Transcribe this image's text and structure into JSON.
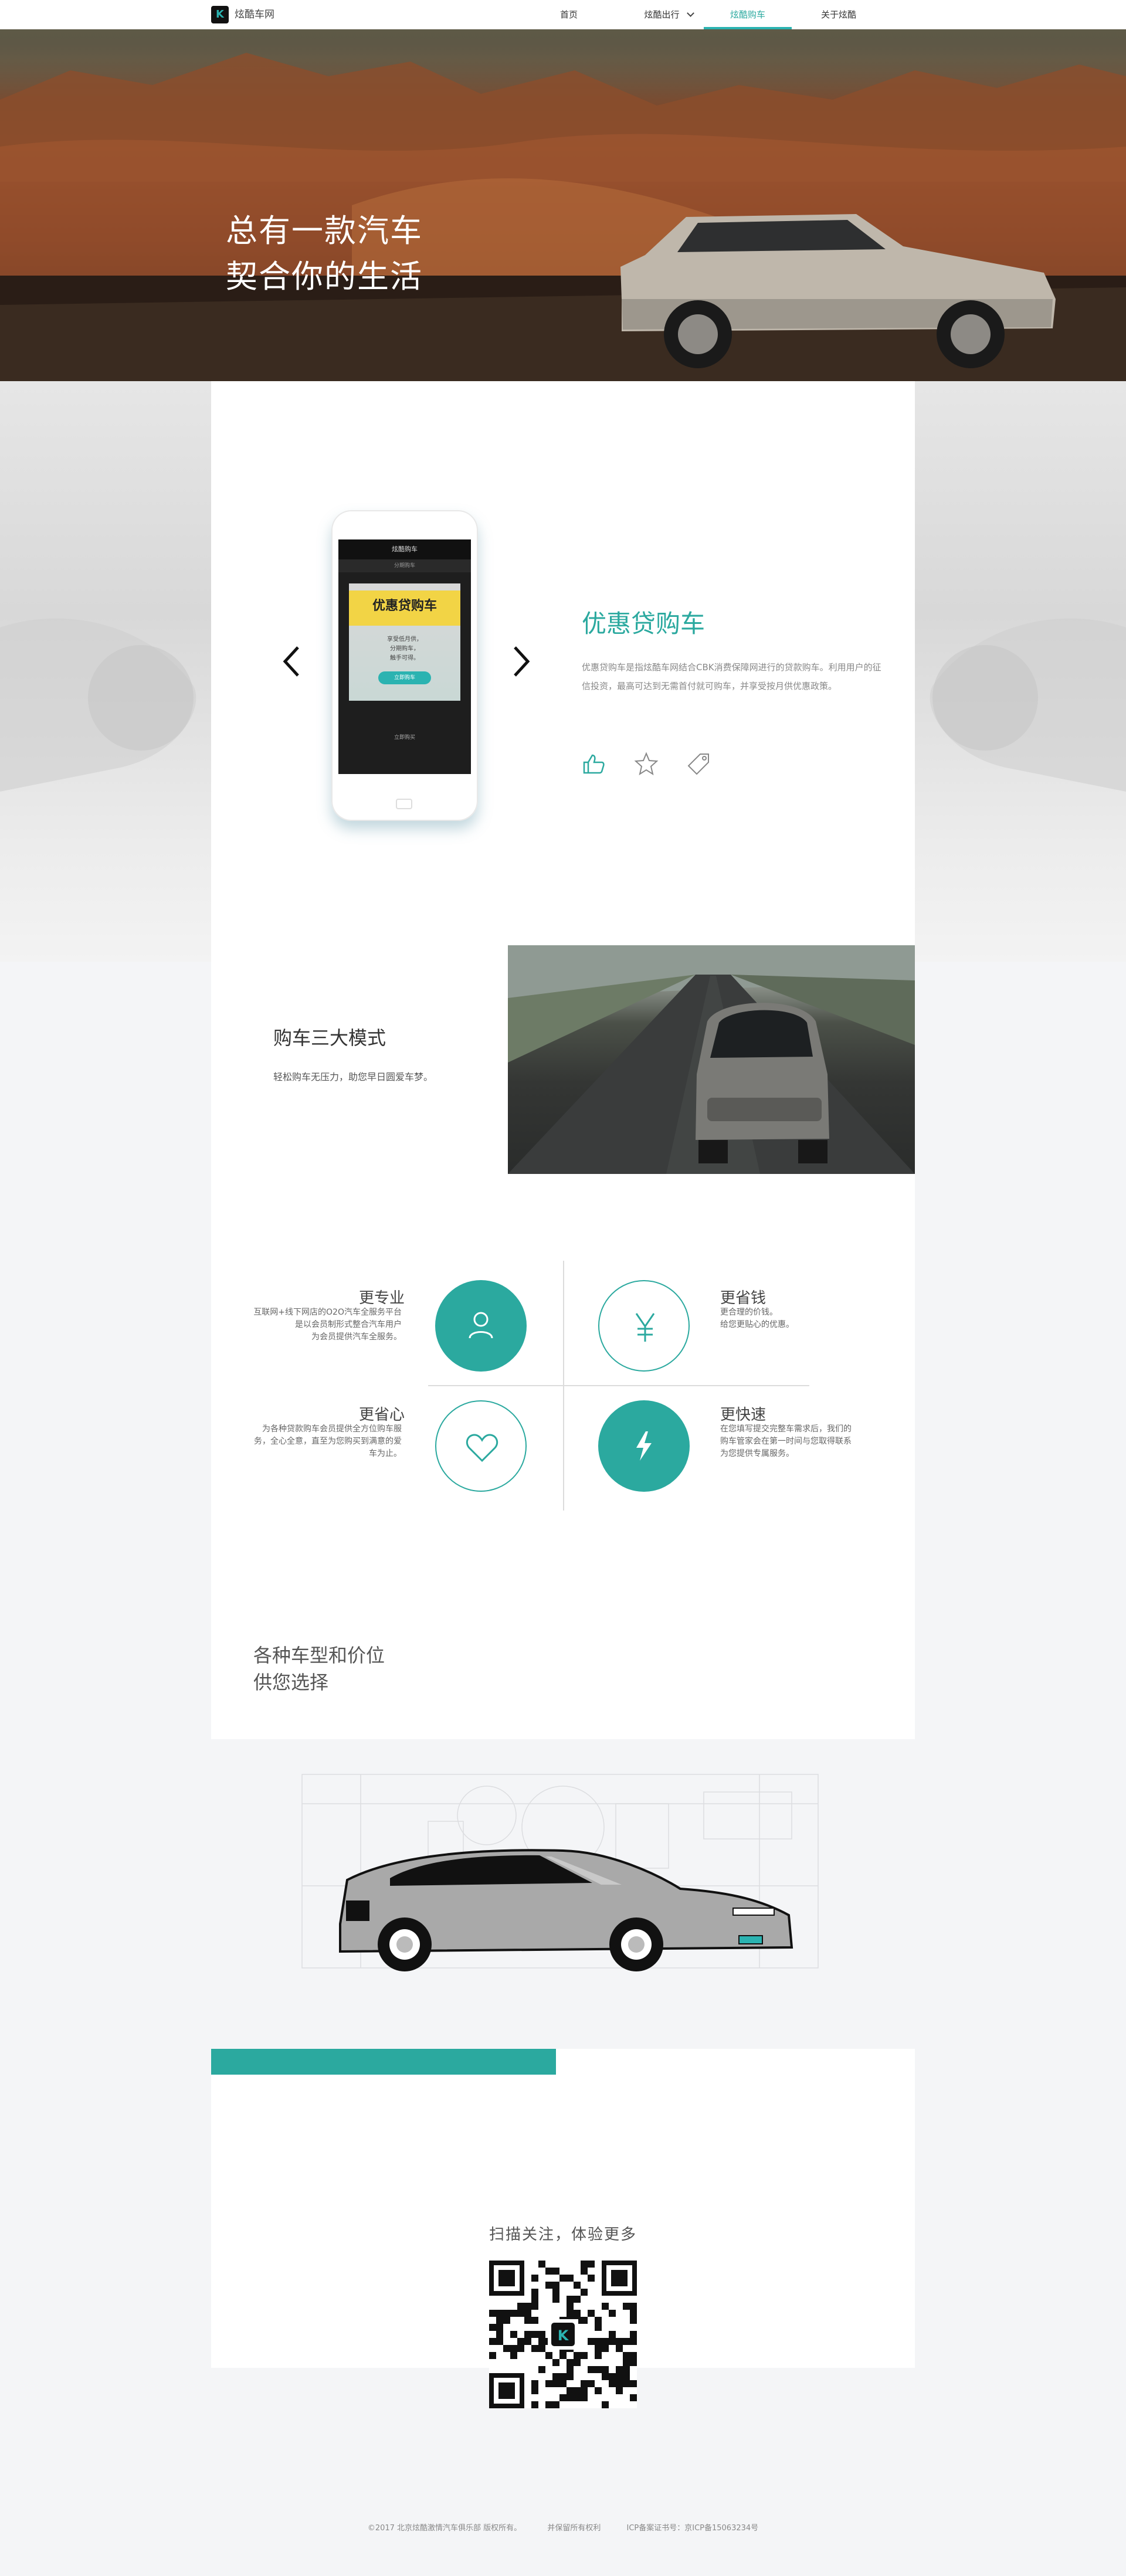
{
  "nav": {
    "brand": "炫酷车网",
    "logo_letter": "K",
    "items": [
      {
        "label": "首页",
        "active": false
      },
      {
        "label": "炫酷出行",
        "active": false,
        "dropdown": true
      },
      {
        "label": "炫酷购车",
        "active": true
      },
      {
        "label": "关于炫酷",
        "active": false
      }
    ]
  },
  "hero": {
    "line1": "总有一款汽车",
    "line2": "契合你的生活"
  },
  "promo": {
    "phone": {
      "app_title": "炫酷购车",
      "app_sub": "分期购车",
      "banner_title": "优惠贷购车",
      "banner_text": "享受低月供，\n分期购车，\n触手可得。",
      "banner_button": "立即购车",
      "more": "立即购买"
    },
    "title": "优惠贷购车",
    "description": "优惠贷购车是指炫酷车网结合CBK消费保障网进行的贷款购车。利用用户的征信投资，最高可达到无需首付就可购车，并享受按月供优惠政策。",
    "icons": [
      "thumbs-up-icon",
      "star-icon",
      "tag-icon"
    ]
  },
  "modes": {
    "title": "购车三大模式",
    "description": "轻松购车无压力，助您早日圆爱车梦。"
  },
  "features": [
    {
      "title": "更专业",
      "description": "互联网+线下网店的O2O汽车全服务平台\n是以会员制形式整合汽车用户\n为会员提供汽车全服务。",
      "icon": "user-icon"
    },
    {
      "title": "更省钱",
      "description": "更合理的价钱。\n给您更贴心的优惠。",
      "icon": "yen-icon"
    },
    {
      "title": "更省心",
      "description": "为各种贷款购车会员提供全方位购车服\n务，全心全意，直至为您购买到满意的爱\n车为止。",
      "icon": "heart-icon"
    },
    {
      "title": "更快速",
      "description": "在您填写提交完整车需求后，我们的\n购车管家会在第一时间与您取得联系\n为您提供专属服务。",
      "icon": "lightning-icon"
    }
  ],
  "types": {
    "text": "各种车型和价位\n供您选择"
  },
  "qr": {
    "title": "扫描关注，体验更多"
  },
  "footer": {
    "copyright": "©2017 北京炫酷激情汽车俱乐部 版权所有。",
    "rights": "并保留所有权利",
    "icp": "ICP备案证书号：京ICP备15063234号"
  },
  "colors": {
    "accent": "#2ba99f",
    "accent_light": "#2bb3b1"
  }
}
